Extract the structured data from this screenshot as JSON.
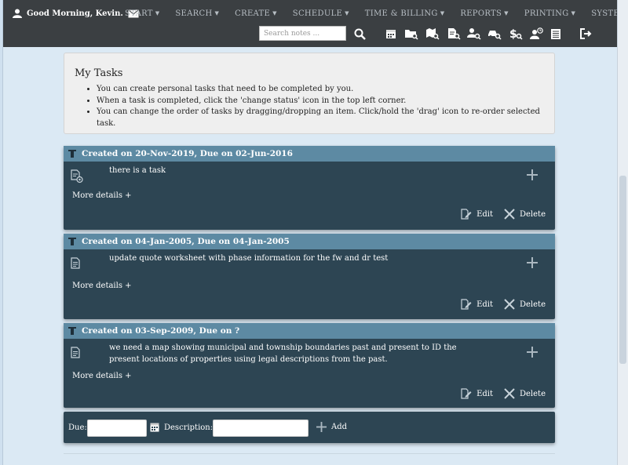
{
  "header": {
    "greeting": "Good Morning, Kevin.",
    "menu": [
      {
        "label": "START"
      },
      {
        "label": "SEARCH"
      },
      {
        "label": "CREATE"
      },
      {
        "label": "SCHEDULE"
      },
      {
        "label": "TIME & BILLING"
      },
      {
        "label": "REPORTS"
      },
      {
        "label": "PRINTING"
      },
      {
        "label": "SYSTEM"
      }
    ],
    "search_placeholder": "Search notes ...",
    "search_value": ""
  },
  "info": {
    "title": "My Tasks",
    "bullets": [
      "You can create personal tasks that need to be completed by you.",
      "When a task is completed, click the 'change status' icon in the top left corner.",
      "You can change the order of tasks by dragging/dropping an item. Click/hold the 'drag' icon to re-order selected task."
    ]
  },
  "tasks": [
    {
      "header": "Created on 20-Nov-2019, Due on 02-Jun-2016",
      "description": "there is a task",
      "more": "More details +",
      "edit": "Edit",
      "delete": "Delete"
    },
    {
      "header": "Created on 04-Jan-2005, Due on 04-Jan-2005",
      "description": "update quote worksheet with phase information for the fw and dr test",
      "more": "More details +",
      "edit": "Edit",
      "delete": "Delete"
    },
    {
      "header": "Created on 03-Sep-2009, Due on ?",
      "description": "we need a map showing municipal and township boundaries past and present to ID the present locations of properties using legal descriptions from the past.",
      "more": "More details +",
      "edit": "Edit",
      "delete": "Delete"
    }
  ],
  "add_task": {
    "due_label": "Due:",
    "due_value": "",
    "description_label": "Description:",
    "description_value": "",
    "add_label": "Add"
  },
  "colors": {
    "nav_bg": "#3b3f42",
    "card_bg": "#2d4553",
    "card_header": "#5d8aa3",
    "page_bg": "#dbe9f4"
  }
}
